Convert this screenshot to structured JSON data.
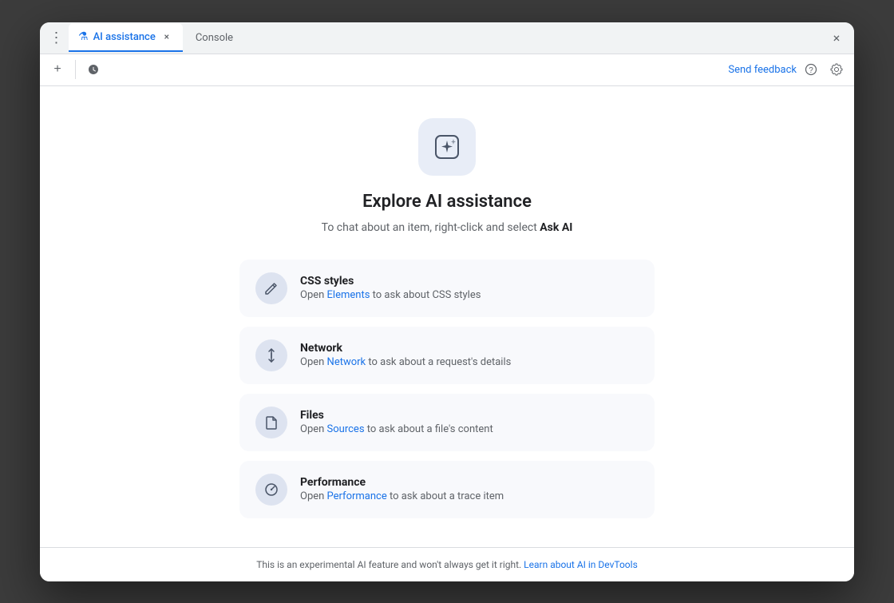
{
  "window": {
    "close_label": "×"
  },
  "title_bar": {
    "dots_label": "⋮",
    "tab_active_label": "AI assistance",
    "tab_active_icon": "⚗",
    "tab_active_close": "×",
    "tab_inactive_label": "Console"
  },
  "toolbar": {
    "new_tab_label": "+",
    "history_label": "↺",
    "send_feedback_label": "Send feedback",
    "help_label": "?",
    "settings_label": "⚙"
  },
  "main": {
    "icon_label": "✦",
    "title": "Explore AI assistance",
    "subtitle_text": "To chat about an item, right-click and select ",
    "subtitle_bold": "Ask AI",
    "cards": [
      {
        "id": "css",
        "icon": "✏",
        "title": "CSS styles",
        "desc_prefix": "Open ",
        "link_text": "Elements",
        "desc_suffix": " to ask about CSS styles"
      },
      {
        "id": "network",
        "icon": "↕",
        "title": "Network",
        "desc_prefix": "Open ",
        "link_text": "Network",
        "desc_suffix": " to ask about a request's details"
      },
      {
        "id": "files",
        "icon": "□",
        "title": "Files",
        "desc_prefix": "Open ",
        "link_text": "Sources",
        "desc_suffix": " to ask about a file's content"
      },
      {
        "id": "performance",
        "icon": "◷",
        "title": "Performance",
        "desc_prefix": "Open ",
        "link_text": "Performance",
        "desc_suffix": " to ask about a trace item"
      }
    ]
  },
  "footer": {
    "text": "This is an experimental AI feature and won't always get it right.",
    "link_text": "Learn about AI in DevTools"
  }
}
